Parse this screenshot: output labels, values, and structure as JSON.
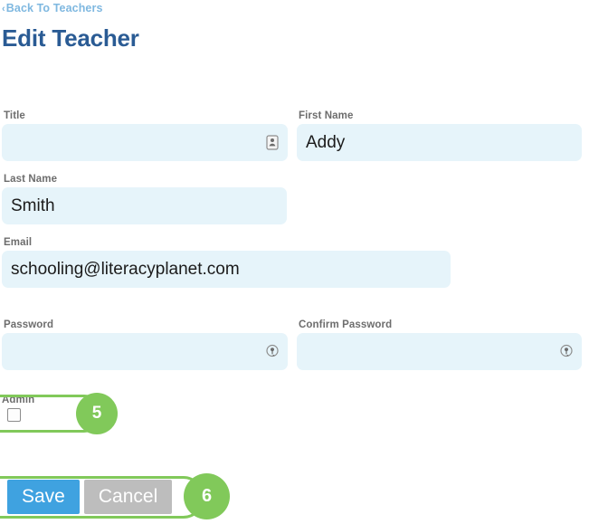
{
  "header": {
    "back_link": "Back To Teachers",
    "back_chevron": "‹",
    "title": "Edit Teacher"
  },
  "form": {
    "fields": [
      {
        "name": "title",
        "label": "Title",
        "value": "",
        "placeholder": "",
        "icon": "contact-card-icon"
      },
      {
        "name": "first_name",
        "label": "First Name",
        "value": "Addy",
        "placeholder": "",
        "icon": null
      },
      {
        "name": "last_name",
        "label": "Last Name",
        "value": "Smith",
        "placeholder": "",
        "icon": null
      },
      {
        "name": "email",
        "label": "Email",
        "value": "schooling@literacyplanet.com",
        "placeholder": "",
        "icon": null
      },
      {
        "name": "password",
        "label": "Password",
        "value": "",
        "placeholder": "",
        "icon": "key-icon"
      },
      {
        "name": "confirm_password",
        "label": "Confirm Password",
        "value": "",
        "placeholder": "",
        "icon": "key-icon"
      }
    ],
    "admin": {
      "label": "Admin",
      "checked": false
    }
  },
  "buttons": {
    "save_label": "Save",
    "cancel_label": "Cancel"
  },
  "annotations": [
    {
      "name": "admin-checkbox-annotation",
      "badge": "5"
    },
    {
      "name": "buttons-annotation",
      "badge": "6"
    }
  ],
  "colors": {
    "link": "#7fb8e0",
    "title": "#2a5b94",
    "label": "#6d6d6d",
    "field_bg": "#e6f4fa",
    "save_button": "#3fa2e0",
    "cancel_button": "#bdbdbd",
    "annotation_green": "#81c95a"
  }
}
